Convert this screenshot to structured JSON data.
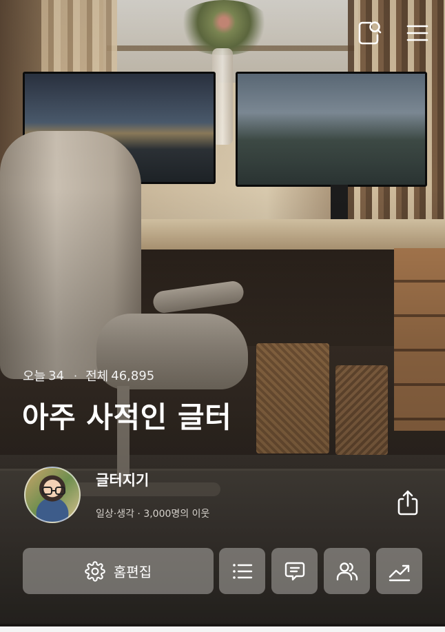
{
  "header": {
    "search_icon": "search-doc-icon",
    "menu_icon": "hamburger-menu-icon"
  },
  "stats": {
    "today_label": "오늘",
    "today_count": "34",
    "separator": "·",
    "total_label": "전체",
    "total_count": "46,895"
  },
  "blog": {
    "title": "아주 사적인 글터"
  },
  "profile": {
    "nickname": "글터지기",
    "meta": "일상·생각 · 3,000명의 이웃"
  },
  "actions": {
    "edit_home_label": "홈편집",
    "edit_icon": "gear-icon",
    "list_icon": "list-icon",
    "comment_icon": "comment-icon",
    "neighbors_icon": "people-icon",
    "stats_icon": "trend-chart-icon",
    "share_icon": "share-icon"
  },
  "colors": {
    "button_bg": "#d7d4cf",
    "text": "#ffffff",
    "meta_text": "#d6d2cc"
  }
}
